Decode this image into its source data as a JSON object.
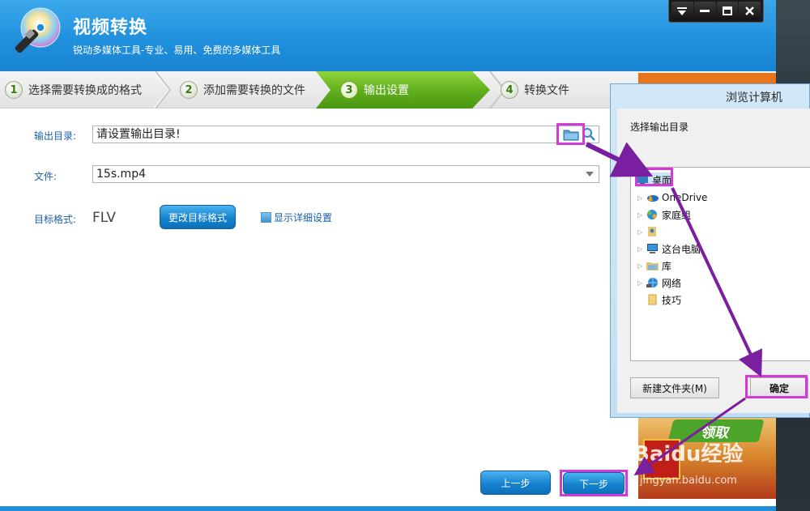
{
  "app": {
    "title": "视频转换",
    "subtitle": "锐动多媒体工具-专业、易用、免费的多媒体工具"
  },
  "steps": [
    {
      "num": "1",
      "label": "选择需要转换成的格式"
    },
    {
      "num": "2",
      "label": "添加需要转换的文件"
    },
    {
      "num": "3",
      "label": "输出设置"
    },
    {
      "num": "4",
      "label": "转换文件"
    }
  ],
  "form": {
    "output_dir_label": "输出目录:",
    "output_dir_value": "请设置输出目录!",
    "file_label": "文件:",
    "file_value": "15s.mp4",
    "format_label": "目标格式:",
    "format_value": "FLV",
    "change_format_button": "更改目标格式",
    "show_details_label": "显示详细设置"
  },
  "nav": {
    "prev_button": "上一步",
    "next_button": "下一步"
  },
  "ad": {
    "tag_text": "领取"
  },
  "watermark": {
    "text": "Baidu经验",
    "sub": "jingyan.baidu.com"
  },
  "dialog": {
    "title": "浏览计算机",
    "prompt": "选择输出目录",
    "tree": [
      {
        "label": "桌面"
      },
      {
        "label": "OneDrive"
      },
      {
        "label": "家庭组"
      },
      {
        "label": ""
      },
      {
        "label": "这台电脑"
      },
      {
        "label": "库"
      },
      {
        "label": "网络"
      },
      {
        "label": "技巧"
      }
    ],
    "new_folder_button": "新建文件夹(M)",
    "ok_button": "确定"
  },
  "colors": {
    "header_blue": "#1f8fdc",
    "active_step_green": "#6cb624",
    "highlight_magenta": "#d33ad8",
    "arrow_purple": "#7a1fa0"
  }
}
